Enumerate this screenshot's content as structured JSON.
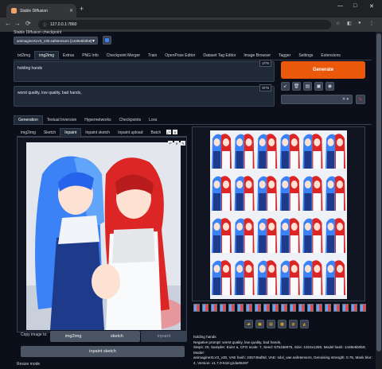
{
  "browser": {
    "tab_title": "Stable Diffusion",
    "url": "127.0.0.1:7860",
    "new_tab": "+",
    "nav": {
      "back": "←",
      "forward": "→",
      "reload": "⟳",
      "home": "⌂"
    },
    "window_controls": {
      "minimize": "—",
      "maximize": "□",
      "close": "✕"
    }
  },
  "checkpoint": {
    "label": "Stable Diffusion checkpoint",
    "value": "animagineXLV3_v30.safetensors [1449e5b0b9]"
  },
  "top_tabs": [
    "txt2img",
    "img2img",
    "Extras",
    "PNG Info",
    "Checkpoint Merger",
    "Train",
    "OpenPose Editor",
    "Dataset Tag Editor",
    "Image Browser",
    "Tagger",
    "Settings",
    "Extensions"
  ],
  "active_top_tab": "img2img",
  "prompt": {
    "text": "holding hands",
    "counter": "2/75"
  },
  "negative_prompt": {
    "text": "worst quality, low quality, bad hands,",
    "counter": "9/75"
  },
  "generate_label": "Generate",
  "gen_tabs": [
    "Generation",
    "Textual Inversion",
    "Hypernetworks",
    "Checkpoints",
    "Lora"
  ],
  "active_gen_tab": "Generation",
  "img_tabs": [
    "img2img",
    "Sketch",
    "Inpaint",
    "Inpaint sketch",
    "Inpaint upload",
    "Batch"
  ],
  "active_img_tab": "Inpaint",
  "copy_image_to": {
    "label": "Copy image to:",
    "buttons": [
      "img2img",
      "sketch",
      "inpaint"
    ],
    "inpaint_sketch": "inpaint sketch"
  },
  "resize_label": "Resize mode",
  "output_info": {
    "lines": [
      "holding hands",
      "Negative prompt: worst quality, low quality, bad hands,",
      "Steps: 20, Sampler: Euler a, CFG scale: 7, Seed: 575158975, Size: 1024x1280, Model hash: 1449e5b0b9, Model:",
      "animagineXLV3_v30, VAE hash: 235745af8d, VAE: sdxl_vae.safetensors, Denoising strength: 0.75, Mask blur:",
      "4, Version: v1.7.0-518-g1da05297"
    ]
  },
  "colors": {
    "accent": "#ea580c",
    "bg": "#0b0f19",
    "panel": "#1f2937"
  }
}
